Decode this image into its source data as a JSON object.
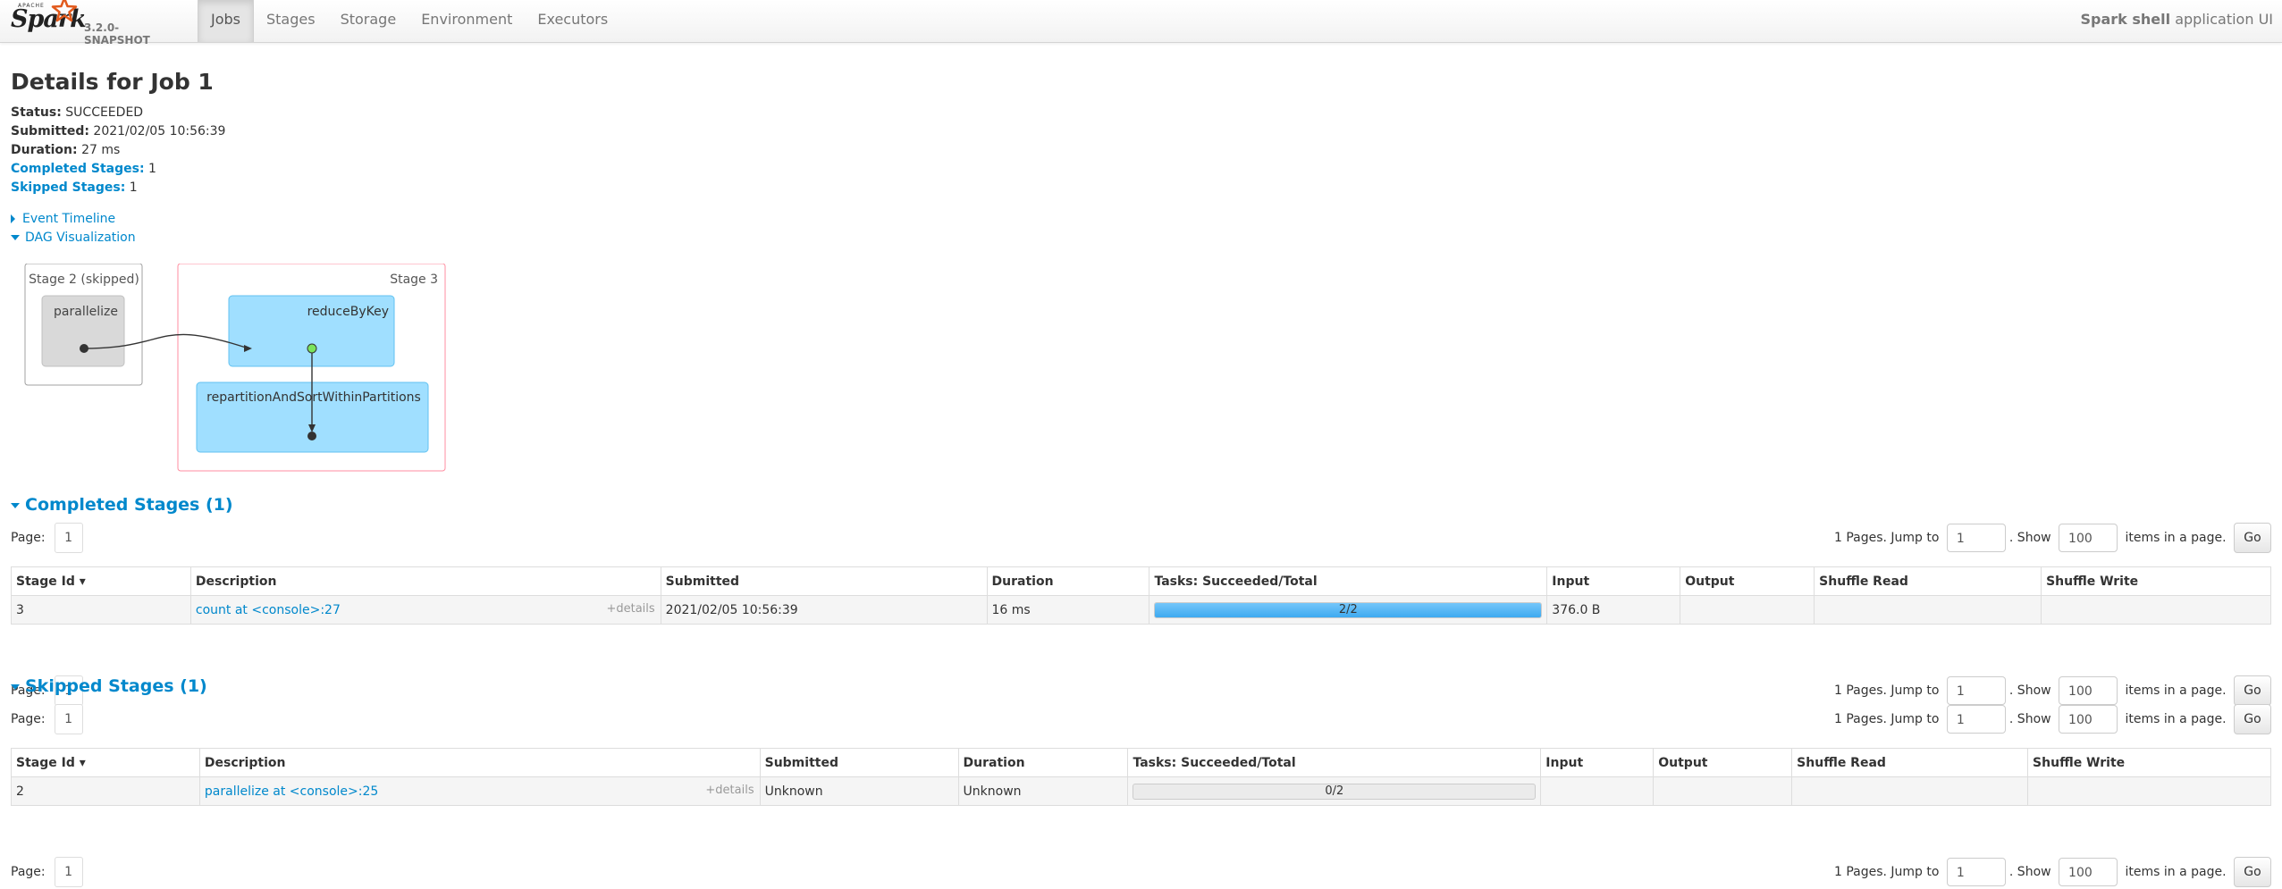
{
  "brand": {
    "word": "Spark",
    "apache": "APACHE",
    "version": "3.2.0-SNAPSHOT"
  },
  "nav": {
    "tabs": [
      {
        "label": "Jobs",
        "active": true
      },
      {
        "label": "Stages"
      },
      {
        "label": "Storage"
      },
      {
        "label": "Environment"
      },
      {
        "label": "Executors"
      }
    ]
  },
  "app": {
    "name": "Spark shell",
    "suffix": "application UI"
  },
  "job": {
    "title": "Details for Job 1",
    "status_label": "Status:",
    "status": "SUCCEEDED",
    "submitted_label": "Submitted:",
    "submitted": "2021/02/05 10:56:39",
    "duration_label": "Duration:",
    "duration": "27 ms",
    "completed_label": "Completed Stages:",
    "completed": "1",
    "skipped_label": "Skipped Stages:",
    "skipped": "1"
  },
  "toggles": {
    "event_timeline": "Event Timeline",
    "dag": "DAG Visualization"
  },
  "dag": {
    "stage2": {
      "label": "Stage 2 (skipped)",
      "op": "parallelize"
    },
    "stage3": {
      "label": "Stage 3",
      "op1": "reduceByKey",
      "op2": "repartitionAndSortWithinPartitions"
    }
  },
  "pager": {
    "page_label": "Page:",
    "page": "1",
    "pages_text": "1 Pages. Jump to",
    "jump_value": "1",
    "show_label": ". Show",
    "show_value": "100",
    "items_label": "items in a page.",
    "go": "Go"
  },
  "completed_section": {
    "title": "Completed Stages (1)",
    "headers": [
      "Stage Id ▾",
      "Description",
      "Submitted",
      "Duration",
      "Tasks: Succeeded/Total",
      "Input",
      "Output",
      "Shuffle Read",
      "Shuffle Write"
    ],
    "row": {
      "id": "3",
      "desc": "count at <console>:27",
      "details": "+details",
      "submitted": "2021/02/05 10:56:39",
      "duration": "16 ms",
      "tasks": "2/2",
      "progress": 1.0,
      "input": "376.0 B",
      "output": "",
      "shuffle_read": "",
      "shuffle_write": ""
    }
  },
  "skipped_section": {
    "title": "Skipped Stages (1)",
    "headers": [
      "Stage Id ▾",
      "Description",
      "Submitted",
      "Duration",
      "Tasks: Succeeded/Total",
      "Input",
      "Output",
      "Shuffle Read",
      "Shuffle Write"
    ],
    "row": {
      "id": "2",
      "desc": "parallelize at <console>:25",
      "details": "+details",
      "submitted": "Unknown",
      "duration": "Unknown",
      "tasks": "0/2",
      "progress": 0.0,
      "input": "",
      "output": "",
      "shuffle_read": "",
      "shuffle_write": ""
    }
  },
  "colors": {
    "link": "#0088cc",
    "progress_fill": "#3eaaf0",
    "dag_node": "#a0dfff",
    "dag_skipped": "#d9d9d9",
    "stage_border": "#ff8ea0"
  }
}
